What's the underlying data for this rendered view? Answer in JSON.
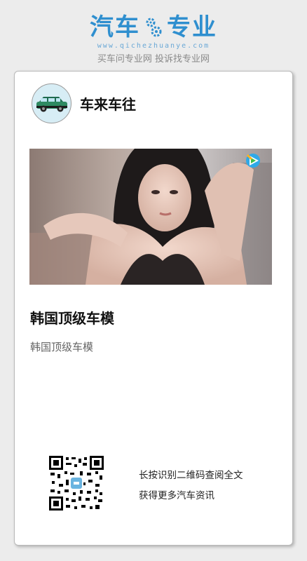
{
  "brand": {
    "logo_left": "汽车",
    "logo_right": "专业",
    "url": "www.qichezhuanye.com",
    "tagline": "买车问专业网 投诉找专业网",
    "accent_color": "#2f8fcf"
  },
  "author": {
    "name": "车来车往",
    "avatar_icon": "car-icon"
  },
  "article": {
    "thumbnail_icon": "video-thumbnail",
    "play_icon": "play-icon",
    "title": "韩国顶级车模",
    "summary": "韩国顶级车模"
  },
  "footer": {
    "qr_icon": "qr-code-icon",
    "line1": "长按识别二维码查阅全文",
    "line2": "获得更多汽车资讯"
  }
}
